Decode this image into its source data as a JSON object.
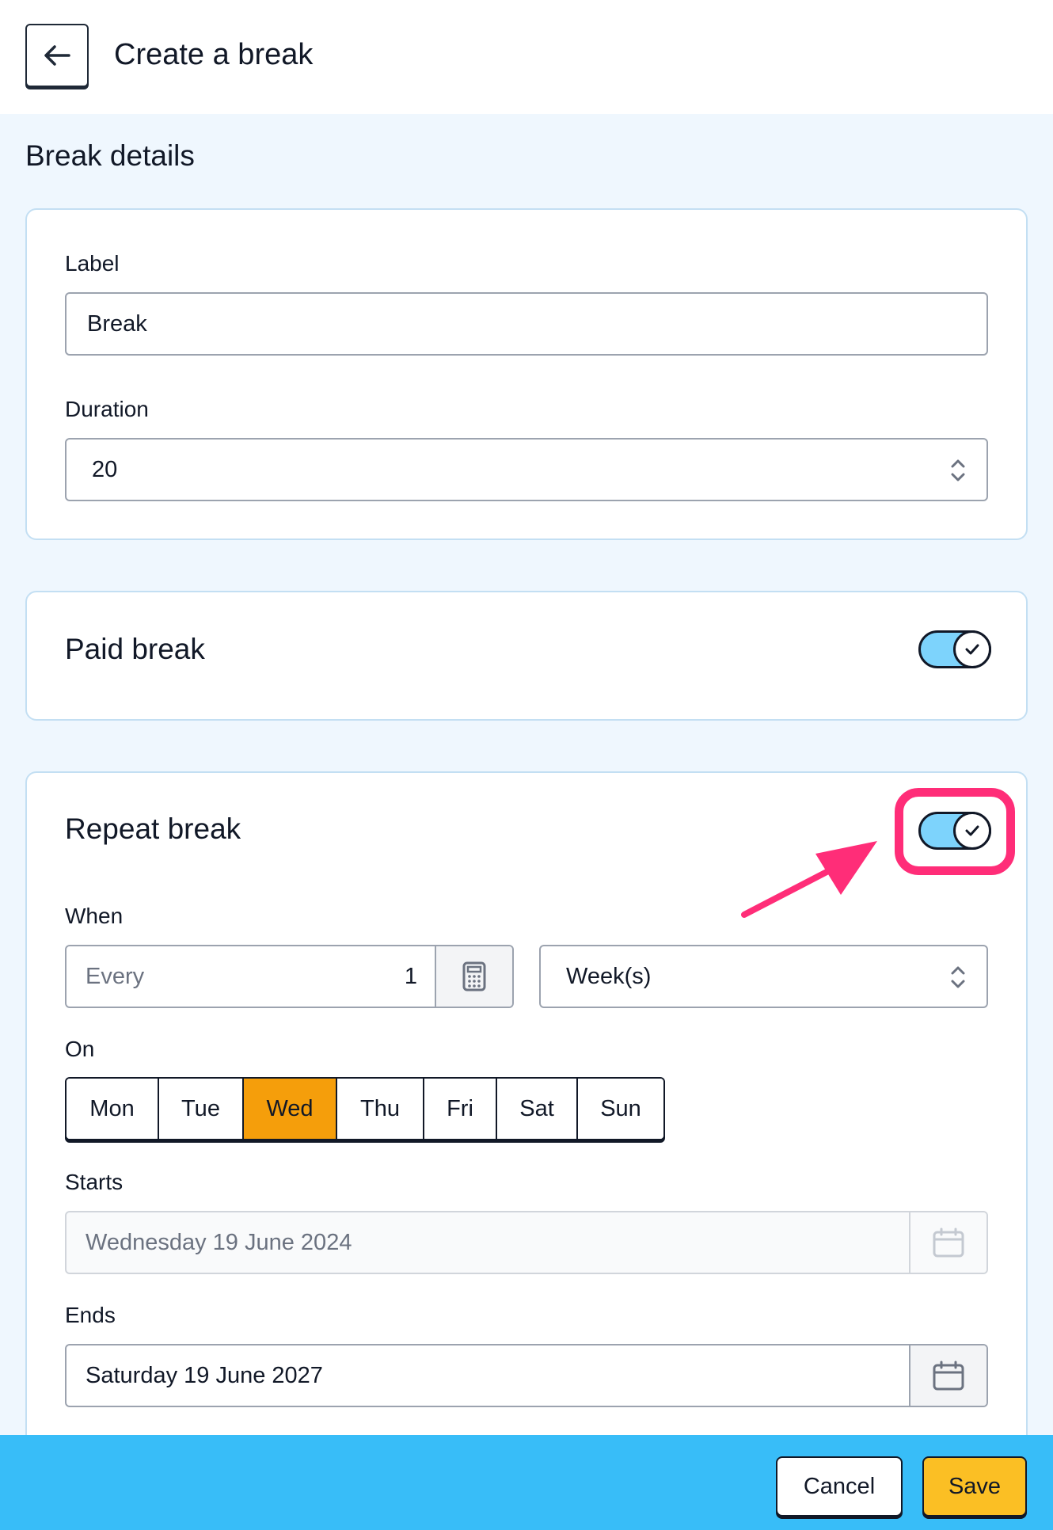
{
  "header": {
    "title": "Create a break"
  },
  "section": {
    "title": "Break details"
  },
  "details": {
    "label_field": {
      "label": "Label",
      "value": "Break"
    },
    "duration_field": {
      "label": "Duration",
      "value": "20"
    }
  },
  "paid_break": {
    "title": "Paid break",
    "enabled": true
  },
  "repeat_break": {
    "title": "Repeat break",
    "enabled": true,
    "when": {
      "label": "When",
      "every_label": "Every",
      "every_value": "1",
      "unit": "Week(s)"
    },
    "on": {
      "label": "On",
      "days": [
        {
          "label": "Mon",
          "active": false
        },
        {
          "label": "Tue",
          "active": false
        },
        {
          "label": "Wed",
          "active": true
        },
        {
          "label": "Thu",
          "active": false
        },
        {
          "label": "Fri",
          "active": false
        },
        {
          "label": "Sat",
          "active": false
        },
        {
          "label": "Sun",
          "active": false
        }
      ]
    },
    "starts": {
      "label": "Starts",
      "value": "Wednesday 19 June 2024"
    },
    "ends": {
      "label": "Ends",
      "value": "Saturday 19 June 2027"
    }
  },
  "footer": {
    "cancel_label": "Cancel",
    "save_label": "Save"
  },
  "colors": {
    "accent_toggle": "#7dd3fc",
    "active_day": "#f59e0b",
    "footer_bg": "#38bdf8",
    "save_button": "#fbbf24",
    "annotation": "#ff2d78"
  }
}
